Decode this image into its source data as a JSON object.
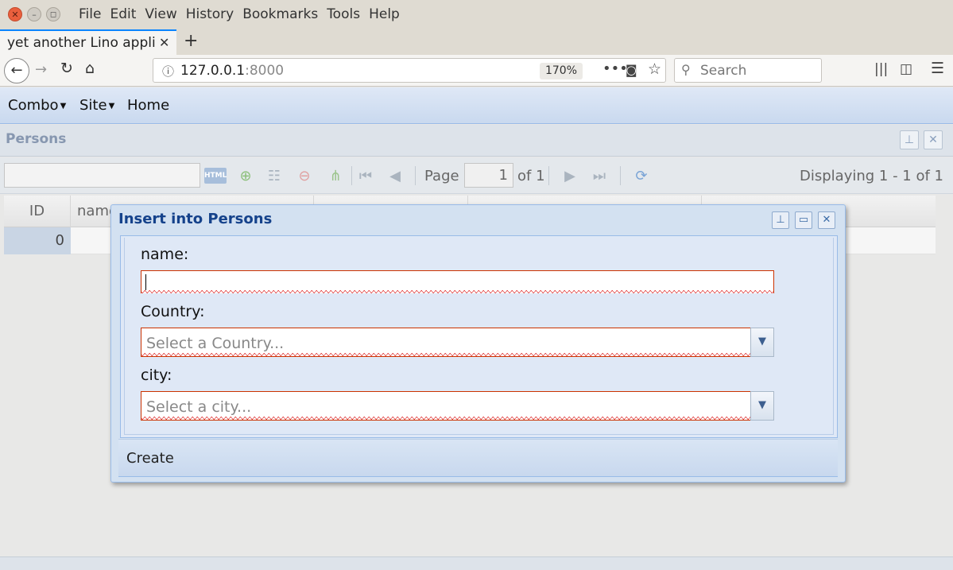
{
  "window": {
    "menu": [
      "File",
      "Edit",
      "View",
      "History",
      "Bookmarks",
      "Tools",
      "Help"
    ],
    "buttons": {
      "close": "✕",
      "minimize": "–",
      "maximize": "◻"
    }
  },
  "browser": {
    "tab_title": "yet another Lino applic",
    "tab_close": "✕",
    "new_tab": "+",
    "url_host": "127.0.0.1",
    "url_port": ":8000",
    "zoom": "170%",
    "search_placeholder": "Search"
  },
  "app": {
    "menu": {
      "combo": "Combo",
      "site": "Site",
      "home": "Home"
    },
    "panel_title": "Persons",
    "toolbar": {
      "html_label": "HTML",
      "page_label": "Page",
      "page_value": "1",
      "page_of": "of 1",
      "displaying": "Displaying 1 - 1 of 1"
    },
    "grid": {
      "columns": [
        "ID",
        "name"
      ],
      "rows": [
        {
          "id": "0"
        }
      ]
    }
  },
  "dialog": {
    "title": "Insert into Persons",
    "fields": {
      "name_label": "name:",
      "country_label": "Country:",
      "country_placeholder": "Select a Country...",
      "city_label": "city:",
      "city_placeholder": "Select a city..."
    },
    "create_label": "Create"
  }
}
